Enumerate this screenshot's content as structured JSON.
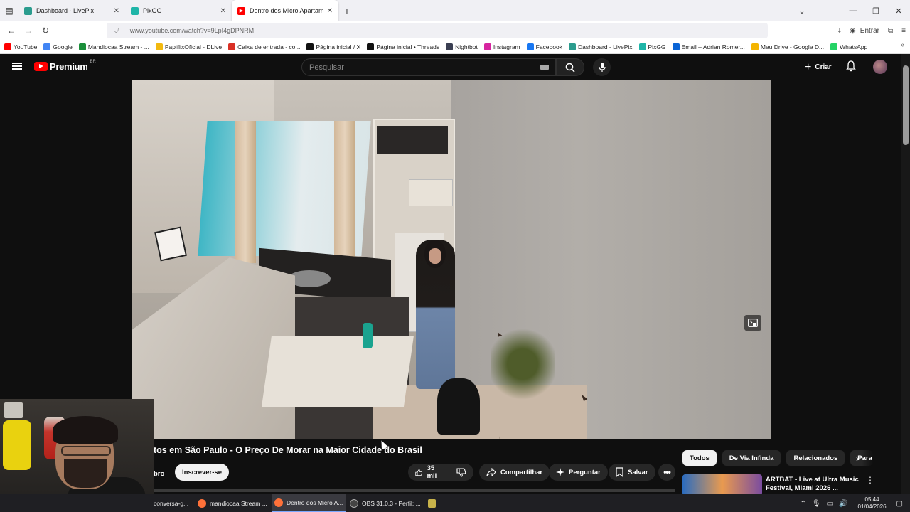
{
  "browser": {
    "tabs": [
      {
        "title": "Dashboard - LivePix",
        "color": "#2b9c8e"
      },
      {
        "title": "PixGG",
        "color": "#1fb5a8"
      },
      {
        "title": "Dentro dos Micro Apartamento",
        "color": "#ff0000"
      }
    ],
    "url": "www.youtube.com/watch?v=9LpI4gDPNRM",
    "signin_label": "Entrar",
    "bookmarks": [
      {
        "label": "YouTube",
        "color": "#ff0000"
      },
      {
        "label": "Google",
        "color": "#4285f4"
      },
      {
        "label": "Mandiocaa Stream - ...",
        "color": "#1b8f3a"
      },
      {
        "label": "PapiflixOficial - DLive",
        "color": "#f2b90f"
      },
      {
        "label": "Caixa de entrada - co...",
        "color": "#d93025"
      },
      {
        "label": "Página inicial / X",
        "color": "#111111"
      },
      {
        "label": "Página inicial • Threads",
        "color": "#111111"
      },
      {
        "label": "Nightbot",
        "color": "#3a3f52"
      },
      {
        "label": "Instagram",
        "color": "#d6249f"
      },
      {
        "label": "Facebook",
        "color": "#1877f2"
      },
      {
        "label": "Dashboard - LivePix",
        "color": "#2b9c8e"
      },
      {
        "label": "PixGG",
        "color": "#1fb5a8"
      },
      {
        "label": "Email – Adrian Romer...",
        "color": "#0a64d6"
      },
      {
        "label": "Meu Drive - Google D...",
        "color": "#f4b400"
      },
      {
        "label": "WhatsApp",
        "color": "#25d366"
      }
    ]
  },
  "youtube": {
    "logo_text": "Premium",
    "logo_region": "BR",
    "search_placeholder": "Pesquisar",
    "create_label": "Criar",
    "video_title": "tos em São Paulo - O Preço De Morar na Maior Cidade do Brasil",
    "member_label": "bro",
    "subscribe_label": "Inscrever-se",
    "likes": "35 mil",
    "share_label": "Compartilhar",
    "ask_label": "Perguntar",
    "save_label": "Salvar",
    "chips": [
      "Todos",
      "De Via Infinda",
      "Relacionados",
      "Para"
    ],
    "recommendation": {
      "title": "ARTBAT - Live at Ultra Music Festival, Miami 2026 ..."
    }
  },
  "taskbar": {
    "items": [
      {
        "label": "conversa-g...",
        "color": "#9aa0a6"
      },
      {
        "label": "mandiocaa Stream ...",
        "color": "#ff7139"
      },
      {
        "label": "Dentro dos Micro A...",
        "color": "#ff7139"
      },
      {
        "label": "OBS 31.0.3 - Perfil: ...",
        "color": "#444444"
      }
    ],
    "time": "05:44",
    "date": "01/04/2026"
  }
}
